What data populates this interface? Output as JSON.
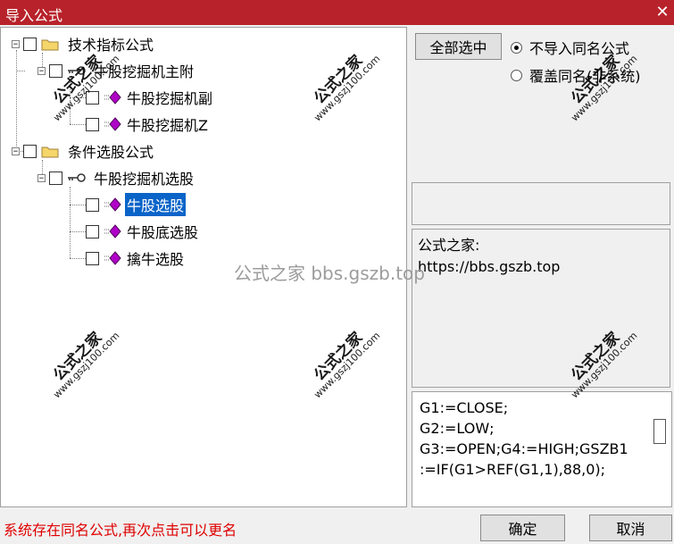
{
  "window": {
    "title": "导入公式",
    "close_glyph": "✕"
  },
  "tree": {
    "groups": [
      {
        "label": "技术指标公式",
        "child": {
          "label": "牛股挖掘机主附",
          "items": [
            "牛股挖掘机副",
            "牛股挖掘机Z"
          ]
        }
      },
      {
        "label": "条件选股公式",
        "child": {
          "label": "牛股挖掘机选股",
          "items": [
            "牛股选股",
            "牛股底选股",
            "擒牛选股"
          ]
        }
      }
    ],
    "selected_item": "牛股选股",
    "expander_glyph": "−"
  },
  "buttons": {
    "select_all": "全部选中",
    "ok": "确定",
    "cancel": "取消"
  },
  "options": {
    "no_import_same_name": "不导入同名公式",
    "overwrite_same_name": "覆盖同名(非系统)",
    "selected": "no_import_same_name"
  },
  "info": {
    "line1": "公式之家:",
    "line2": "https://bbs.gszb.top"
  },
  "code": {
    "lines": [
      "G1:=CLOSE;",
      "G2:=LOW;",
      "G3:=OPEN;G4:=HIGH;GSZB1",
      ":=IF(G1>REF(G1,1),88,0);"
    ]
  },
  "status": "系统存在同名公式,再次点击可以更名",
  "watermarks": {
    "center": "公式之家 bbs.gszb.top",
    "stamp_big": "公式之家",
    "stamp_small": "www.gszj100.com"
  },
  "colors": {
    "titlebar": "#b8222a",
    "selection": "#0a64c8",
    "status_text": "#e00000",
    "gem": "#b000c8"
  }
}
